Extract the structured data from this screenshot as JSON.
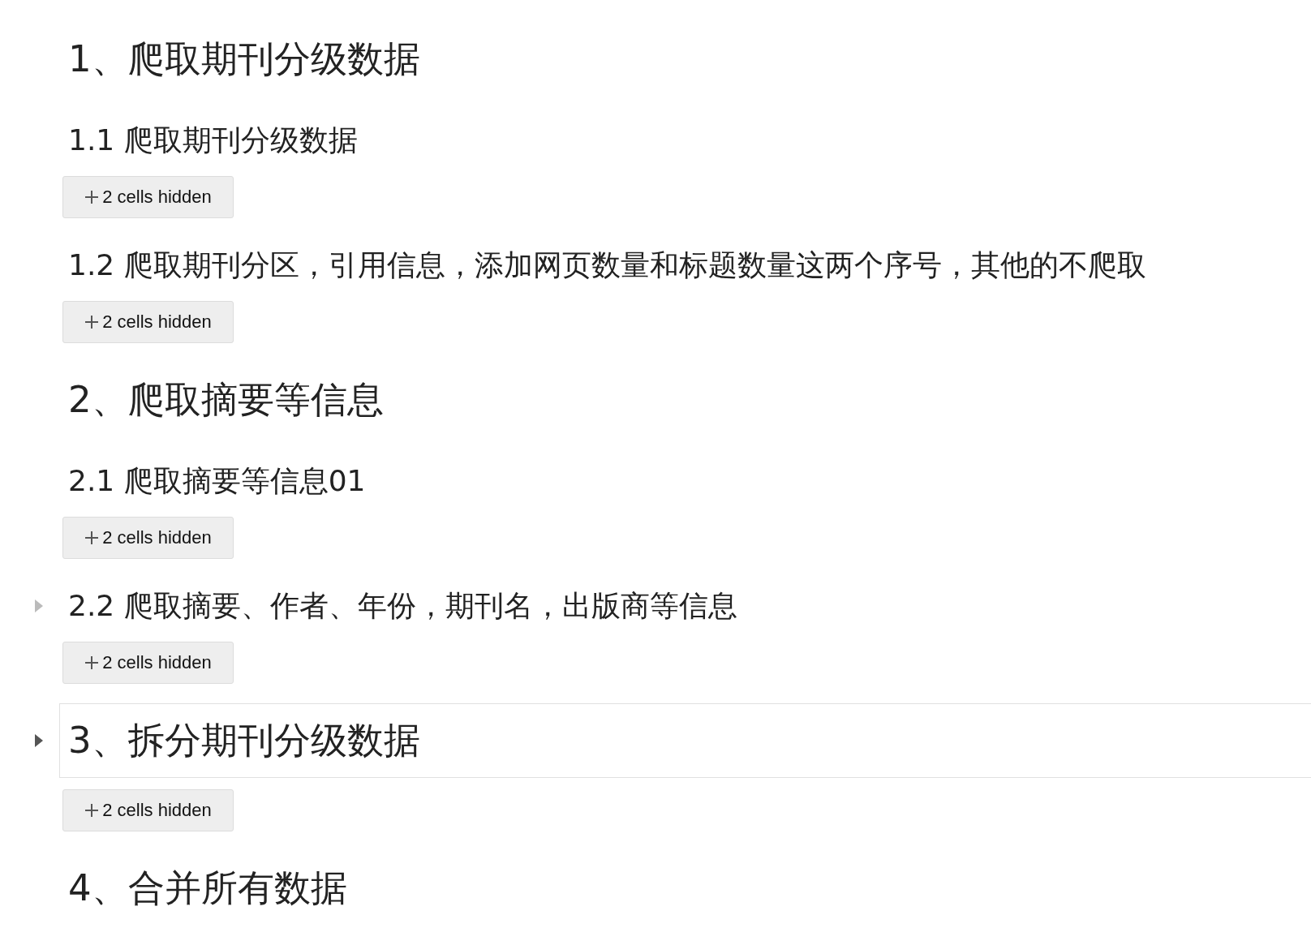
{
  "cells": [
    {
      "kind": "section",
      "text": "1、爬取期刊分级数据",
      "selected": false,
      "hovered": false
    },
    {
      "kind": "subsection",
      "text": "1.1 爬取期刊分级数据",
      "selected": false,
      "hovered": false
    },
    {
      "kind": "hidden",
      "label": "2 cells hidden"
    },
    {
      "kind": "subsection",
      "text": "1.2 爬取期刊分区，引用信息，添加网页数量和标题数量这两个序号，其他的不爬取",
      "selected": false,
      "hovered": false
    },
    {
      "kind": "hidden",
      "label": "2 cells hidden"
    },
    {
      "kind": "section",
      "text": "2、爬取摘要等信息",
      "selected": false,
      "hovered": false
    },
    {
      "kind": "subsection",
      "text": "2.1 爬取摘要等信息01",
      "selected": false,
      "hovered": false
    },
    {
      "kind": "hidden",
      "label": "2 cells hidden"
    },
    {
      "kind": "subsection",
      "text": "2.2 爬取摘要、作者、年份，期刊名，出版商等信息",
      "selected": false,
      "hovered": true
    },
    {
      "kind": "hidden",
      "label": "2 cells hidden"
    },
    {
      "kind": "section",
      "text": "3、拆分期刊分级数据",
      "selected": true,
      "hovered": false
    },
    {
      "kind": "hidden",
      "label": "2 cells hidden"
    },
    {
      "kind": "section",
      "text": "4、合并所有数据",
      "selected": false,
      "hovered": false
    }
  ]
}
